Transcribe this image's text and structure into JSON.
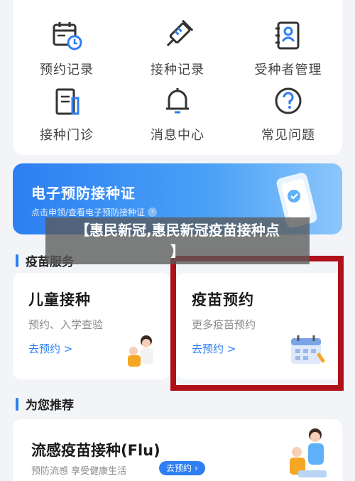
{
  "quick_access": [
    {
      "label": "预约记录",
      "icon": "calendar-clock-icon"
    },
    {
      "label": "接种记录",
      "icon": "syringe-icon"
    },
    {
      "label": "受种者管理",
      "icon": "person-card-icon"
    },
    {
      "label": "接种门诊",
      "icon": "clinic-building-icon"
    },
    {
      "label": "消息中心",
      "icon": "bell-icon"
    },
    {
      "label": "常见问题",
      "icon": "question-circle-icon"
    }
  ],
  "cert_banner": {
    "title": "电子预防接种证",
    "subtitle": "点击申领/查看电子预防接种证",
    "arrow": "›"
  },
  "caption": {
    "line1": "【惠民新冠,惠民新冠疫苗接种点",
    "line2": "】"
  },
  "vaccine_services": {
    "section_title": "疫苗服务",
    "cards": [
      {
        "title": "儿童接种",
        "desc": "预约、入学查验",
        "link": "去预约 >"
      },
      {
        "title": "疫苗预约",
        "desc": "更多疫苗预约",
        "link": "去预约 >"
      }
    ]
  },
  "recommend": {
    "section_title": "为您推荐",
    "flu": {
      "title": "流感疫苗接种(Flu)",
      "desc": "预防流感 享受健康生活",
      "button": "去预约 ›"
    }
  },
  "colors": {
    "accent": "#2d7ff2",
    "highlight_frame": "#b0101a"
  }
}
